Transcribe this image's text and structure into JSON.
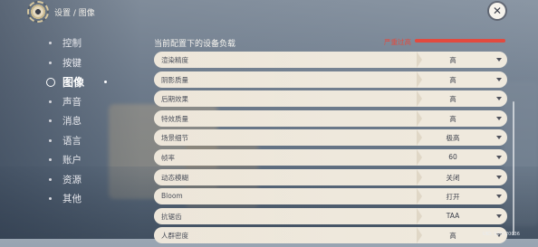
{
  "header": {
    "breadcrumb": "设置 / 图像",
    "close_symbol": "✕"
  },
  "sidebar": {
    "items": [
      {
        "label": "控制",
        "active": false
      },
      {
        "label": "按键",
        "active": false
      },
      {
        "label": "图像",
        "active": true
      },
      {
        "label": "声音",
        "active": false
      },
      {
        "label": "消息",
        "active": false
      },
      {
        "label": "语言",
        "active": false
      },
      {
        "label": "账户",
        "active": false
      },
      {
        "label": "资源",
        "active": false
      },
      {
        "label": "其他",
        "active": false
      }
    ]
  },
  "device_load": {
    "title": "当前配置下的设备负载",
    "level_label": "严重过高",
    "level_color": "#e24a3f"
  },
  "settings": [
    {
      "label": "渲染精度",
      "value": "高"
    },
    {
      "label": "阴影质量",
      "value": "高"
    },
    {
      "label": "后期效果",
      "value": "高"
    },
    {
      "label": "特效质量",
      "value": "高"
    },
    {
      "label": "场景细节",
      "value": "极高"
    },
    {
      "label": "帧率",
      "value": "60"
    },
    {
      "label": "动态模糊",
      "value": "关闭"
    },
    {
      "label": "Bloom",
      "value": "打开"
    },
    {
      "label": "抗锯齿",
      "value": "TAA"
    },
    {
      "label": "人群密度",
      "value": "高"
    }
  ],
  "footer": {
    "uid_text": "UID: 100720036"
  },
  "colors": {
    "row_bg": "#ece5d8",
    "text_dark": "#3d414c",
    "sidebar_text": "#e8e9ee"
  }
}
